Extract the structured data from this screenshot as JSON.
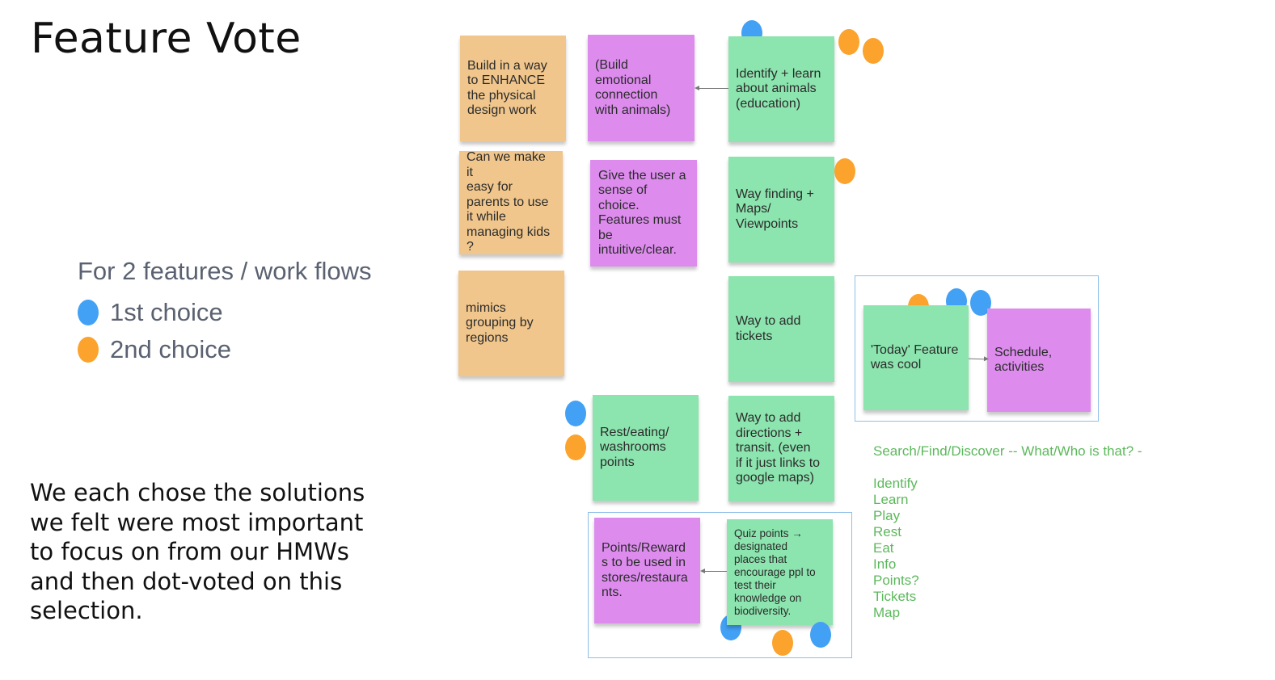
{
  "title": "Feature Vote",
  "legend": {
    "heading": "For 2 features / work flows",
    "items": [
      {
        "label": "1st choice",
        "color": "#42a1f5"
      },
      {
        "label": "2nd choice",
        "color": "#fba32c"
      }
    ]
  },
  "description": "We each chose the solutions we felt were most important to focus on from our HMWs and then dot-voted on this selection.",
  "colors": {
    "vote_first": "#42a1f5",
    "vote_second": "#fba32c",
    "note_orange": "#f0c68c",
    "note_purple": "#dd8cee",
    "note_green": "#8ce4ae",
    "category_text": "#5cb85c"
  },
  "notes": {
    "enhance_design": "Build in a way\nto ENHANCE\nthe physical\ndesign work",
    "emotional_connection": "(Build\nemotional\nconnection\nwith animals)",
    "identify_learn": "Identify + learn\nabout animals\n(education)",
    "parents_kids": "Can we make it\neasy for\nparents to use\nit while\nmanaging kids\n?",
    "sense_of_choice": "Give the user a\nsense of\nchoice.\nFeatures must\nbe\nintuitive/clear.",
    "way_finding": "Way finding +\nMaps/\nViewpoints",
    "grouping_regions": "mimics\ngrouping by\nregions",
    "add_tickets": "Way to add\ntickets",
    "today_feature": "'Today' Feature\nwas cool",
    "schedule": "Schedule,\nactivities",
    "rest_eating": "Rest/eating/\nwashrooms\npoints",
    "directions_transit": "Way to add\ndirections +\ntransit.  (even\nif it just links to\ngoogle maps)",
    "points_rewards": "Points/Reward\ns to be used in\nstores/restaura\nnts.",
    "quiz_points": "Quiz points →\ndesignated\nplaces that\nencourage ppl to\ntest their\nknowledge on\nbiodiversity."
  },
  "votes": {
    "identify_learn": {
      "first": 1,
      "second": 2
    },
    "way_finding": {
      "first": 0,
      "second": 1
    },
    "today_schedule": {
      "first": 2,
      "second": 1
    },
    "rest_eating": {
      "first": 1,
      "second": 1
    },
    "quiz_points": {
      "first": 2,
      "second": 1
    }
  },
  "categories": {
    "heading": "Search/Find/Discover -- What/Who is that? -",
    "items": [
      "Identify",
      "Learn",
      "Play",
      "Rest",
      "Eat",
      "Info",
      "Points?",
      "Tickets",
      "Map"
    ]
  }
}
